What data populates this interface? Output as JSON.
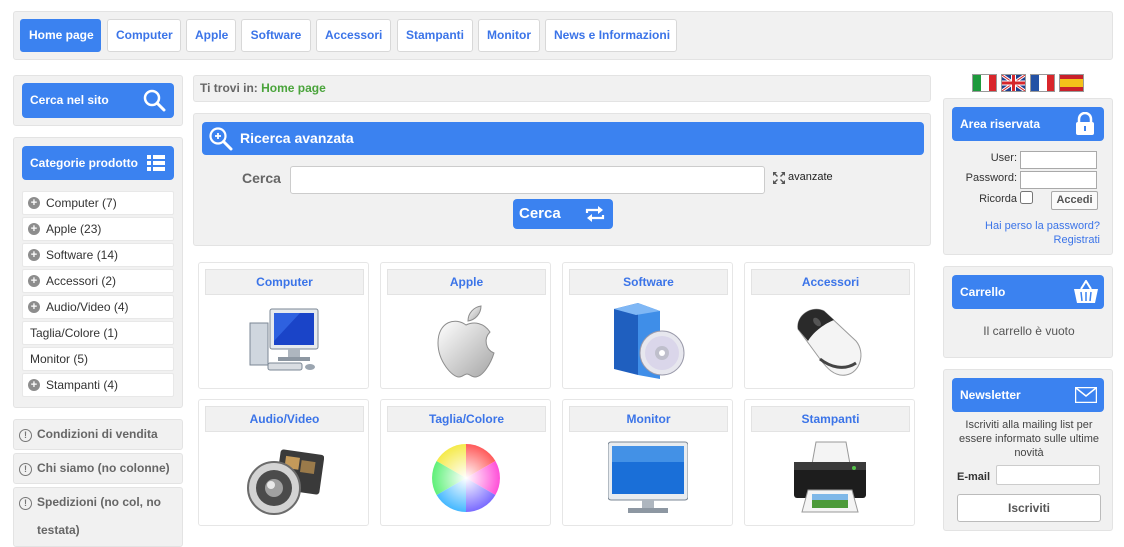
{
  "nav": {
    "tabs": [
      {
        "label": "Home page"
      },
      {
        "label": "Computer"
      },
      {
        "label": "Apple"
      },
      {
        "label": "Software"
      },
      {
        "label": "Accessori"
      },
      {
        "label": "Stampanti"
      },
      {
        "label": "Monitor"
      },
      {
        "label": "News e Informazioni"
      }
    ]
  },
  "sidebar": {
    "search_label": "Cerca nel sito",
    "categories_label": "Categorie prodotto",
    "categories": [
      {
        "label": "Computer (7)"
      },
      {
        "label": "Apple (23)"
      },
      {
        "label": "Software (14)"
      },
      {
        "label": "Accessori (2)"
      },
      {
        "label": "Audio/Video (4)"
      },
      {
        "label": "Taglia/Colore (1)"
      },
      {
        "label": "Monitor (5)"
      },
      {
        "label": "Stampanti (4)"
      }
    ],
    "info": [
      {
        "label": "Condizioni di vendita"
      },
      {
        "label": "Chi siamo (no colonne)"
      },
      {
        "label": "Spedizioni (no col, no testata)"
      }
    ]
  },
  "breadcrumb": {
    "prefix": "Ti trovi in:",
    "current": "Home page"
  },
  "advanced_search": {
    "title": "Ricerca avanzata",
    "label": "Cerca",
    "input_value": "",
    "advanced_label": "avanzate",
    "button_label": "Cerca"
  },
  "tiles": [
    {
      "label": "Computer",
      "icon": "computer-icon"
    },
    {
      "label": "Apple",
      "icon": "apple-icon"
    },
    {
      "label": "Software",
      "icon": "software-box-icon"
    },
    {
      "label": "Accessori",
      "icon": "mouse-icon"
    },
    {
      "label": "Audio/Video",
      "icon": "speaker-film-icon"
    },
    {
      "label": "Taglia/Colore",
      "icon": "color-wheel-icon"
    },
    {
      "label": "Monitor",
      "icon": "monitor-icon"
    },
    {
      "label": "Stampanti",
      "icon": "printer-icon"
    }
  ],
  "flags": [
    "italian-flag-icon",
    "uk-flag-icon",
    "french-flag-icon",
    "spanish-flag-icon"
  ],
  "login": {
    "title": "Area riservata",
    "user_label": "User:",
    "password_label": "Password:",
    "remember_label": "Ricorda",
    "submit_label": "Accedi",
    "forgot_link": "Hai perso la password?",
    "register_link": "Registrati"
  },
  "cart": {
    "title": "Carrello",
    "empty_text": "Il carrello è vuoto"
  },
  "newsletter": {
    "title": "Newsletter",
    "description": "Iscriviti alla mailing list per essere informato sulle ultime novità",
    "email_label": "E-mail",
    "email_value": "",
    "submit_label": "Iscriviti"
  },
  "colors": {
    "accent": "#3b82f0",
    "link": "#3b74e8",
    "breadcrumb_current": "#4aa43b",
    "panel_bg": "#f1f1f1"
  }
}
